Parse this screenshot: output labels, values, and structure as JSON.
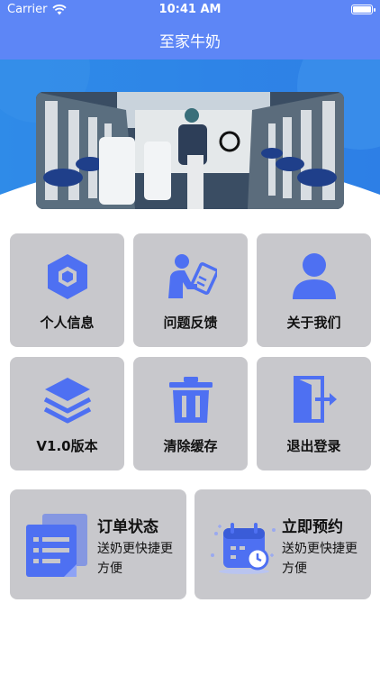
{
  "status_bar": {
    "carrier": "Carrier",
    "time": "10:41 AM"
  },
  "nav": {
    "title": "至家牛奶"
  },
  "colors": {
    "accent": "#5d86f6",
    "icon": "#4e70f2",
    "tile": "#c8c8cc"
  },
  "menu": {
    "items": [
      {
        "label": "个人信息",
        "icon": "hexagon-icon"
      },
      {
        "label": "问题反馈",
        "icon": "feedback-icon"
      },
      {
        "label": "关于我们",
        "icon": "user-icon"
      },
      {
        "label": "V1.0版本",
        "icon": "layers-icon"
      },
      {
        "label": "清除缓存",
        "icon": "trash-icon"
      },
      {
        "label": "退出登录",
        "icon": "logout-icon"
      }
    ]
  },
  "cards": [
    {
      "title": "订单状态",
      "subtitle": "送奶更快捷更方便",
      "icon": "order-list-icon"
    },
    {
      "title": "立即预约",
      "subtitle": "送奶更快捷更方便",
      "icon": "calendar-icon"
    }
  ]
}
